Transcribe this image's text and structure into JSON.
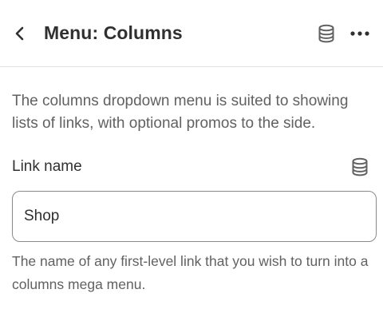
{
  "header": {
    "title": "Menu: Columns",
    "back_icon": "chevron-left-icon",
    "source_icon": "database-icon",
    "more_icon": "more-horizontal-icon"
  },
  "main": {
    "description": "The columns dropdown menu is suited to showing lists of links, with optional promos to the side."
  },
  "link_name_field": {
    "label": "Link name",
    "value": "Shop",
    "help_text": "The name of any first-level link that you wish to turn into a columns mega menu.",
    "source_icon": "database-icon"
  },
  "colors": {
    "text_primary": "#303030",
    "text_secondary": "#616161",
    "border": "#8a8a8a",
    "divider": "#e3e3e3"
  }
}
